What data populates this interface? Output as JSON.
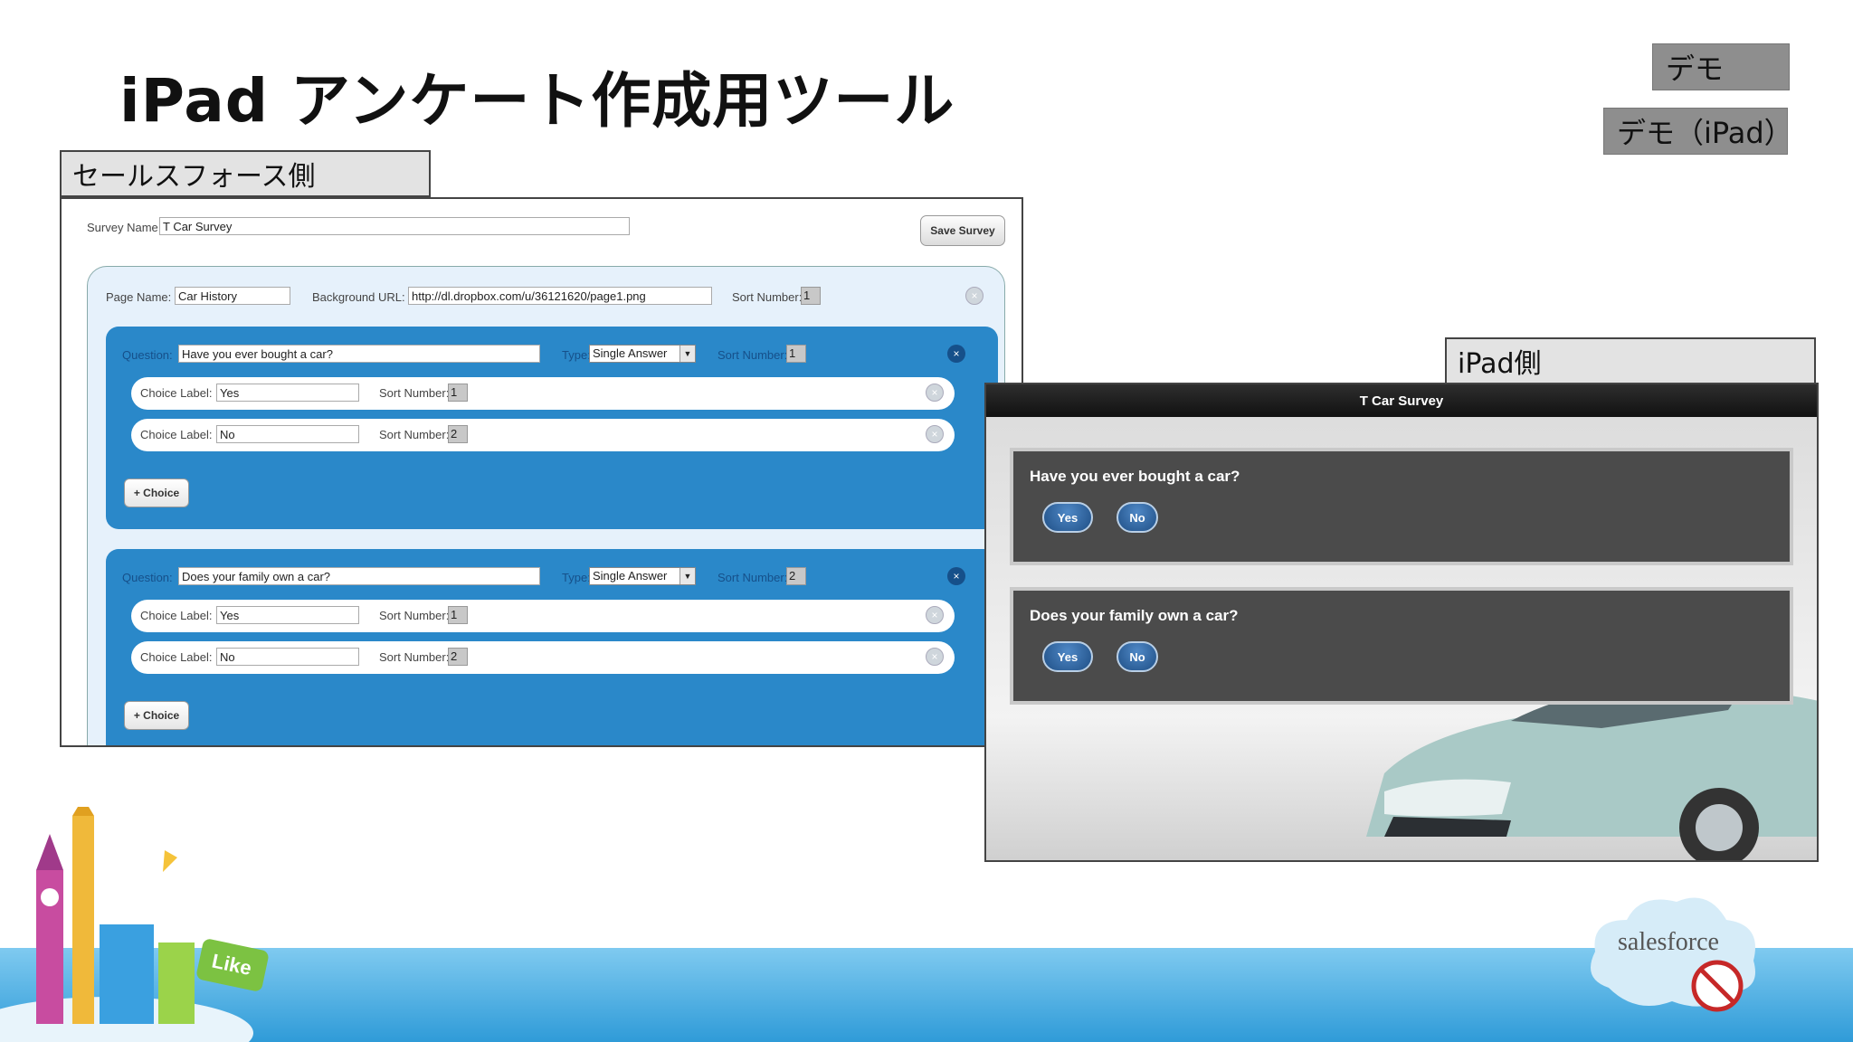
{
  "slide": {
    "title": "iPad アンケート作成用ツール",
    "demo_button": "デモ",
    "demo_ipad_button": "デモ（iPad）",
    "sf_side_label": "セールスフォース側",
    "ipad_side_label": "iPad側"
  },
  "sf": {
    "survey_name_label": "Survey Name",
    "survey_name_value": "T Car Survey",
    "save_button": "Save Survey",
    "page_name_label": "Page Name:",
    "page_name_value": "Car History",
    "bg_url_label": "Background URL:",
    "bg_url_value": "http://dl.dropbox.com/u/36121620/page1.png",
    "sort_label": "Sort Number:",
    "page_sort": "1",
    "questions": [
      {
        "label": "Question:",
        "value": "Have you ever bought a car?",
        "type_label": "Type:",
        "type_value": "Single Answer",
        "sort_label": "Sort Number:",
        "sort": "1",
        "choices": [
          {
            "label": "Choice Label:",
            "value": "Yes",
            "sort_label": "Sort Number:",
            "sort": "1"
          },
          {
            "label": "Choice Label:",
            "value": "No",
            "sort_label": "Sort Number:",
            "sort": "2"
          }
        ],
        "add_choice": "+ Choice"
      },
      {
        "label": "Question:",
        "value": "Does your family own a car?",
        "type_label": "Type:",
        "type_value": "Single Answer",
        "sort_label": "Sort Number:",
        "sort": "2",
        "choices": [
          {
            "label": "Choice Label:",
            "value": "Yes",
            "sort_label": "Sort Number:",
            "sort": "1"
          },
          {
            "label": "Choice Label:",
            "value": "No",
            "sort_label": "Sort Number:",
            "sort": "2"
          }
        ],
        "add_choice": "+ Choice"
      }
    ]
  },
  "ipad": {
    "header": "T Car Survey",
    "questions": [
      {
        "text": "Have you ever bought a car?",
        "answers": [
          "Yes",
          "No"
        ]
      },
      {
        "text": "Does your family own a car?",
        "answers": [
          "Yes",
          "No"
        ]
      }
    ]
  },
  "branding": {
    "logo_text": "salesforce",
    "like_badge": "Like"
  }
}
